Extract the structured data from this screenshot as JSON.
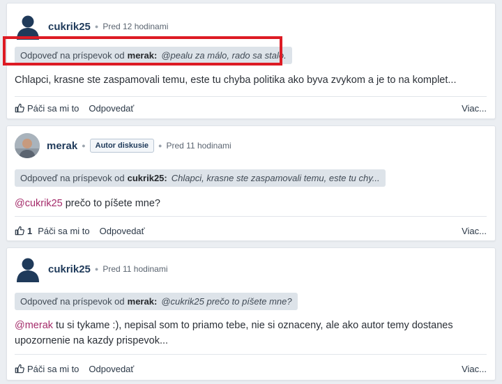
{
  "posts": [
    {
      "username": "cukrik25",
      "time": "Pred 12 hodinami",
      "quote": {
        "prefix": "Odpoveď na príspevok od",
        "author": "merak:",
        "text": "@pealu za málo, rado sa stalo."
      },
      "body": {
        "mention": "",
        "text": "Chlapci, krasne ste zaspamovali temu, este tu chyba politika ako byva zvykom a je to na komplet..."
      },
      "actions": {
        "like": "Páči sa mi to",
        "like_count": "",
        "reply": "Odpovedať",
        "more": "Viac..."
      }
    },
    {
      "username": "merak",
      "badge": "Autor diskusie",
      "time": "Pred 11 hodinami",
      "quote": {
        "prefix": "Odpoveď na príspevok od",
        "author": "cukrik25:",
        "text": "Chlapci, krasne ste zaspamovali temu, este tu chy..."
      },
      "body": {
        "mention": "@cukrik25",
        "text": " prečo to píšete mne?"
      },
      "actions": {
        "like": "Páči sa mi to",
        "like_count": "1",
        "reply": "Odpovedať",
        "more": "Viac..."
      }
    },
    {
      "username": "cukrik25",
      "time": "Pred 11 hodinami",
      "quote": {
        "prefix": "Odpoveď na príspevok od",
        "author": "merak:",
        "text": "@cukrik25 prečo to píšete mne?"
      },
      "body": {
        "mention": "@merak",
        "text": " tu si tykame :), nepisal som to priamo tebe, nie si oznaceny, ale ako autor temy dostanes upozornenie na kazdy prispevok..."
      },
      "actions": {
        "like": "Páči sa mi to",
        "like_count": "",
        "reply": "Odpovedať",
        "more": "Viac..."
      }
    }
  ],
  "colors": {
    "highlight": "#dd1b24",
    "mention": "#a42b6a",
    "username": "#1f3a5a",
    "avatar": "#1f3a5a"
  },
  "icons": [
    "user-silhouette-icon",
    "avatar-photo",
    "thumbs-up-icon"
  ]
}
